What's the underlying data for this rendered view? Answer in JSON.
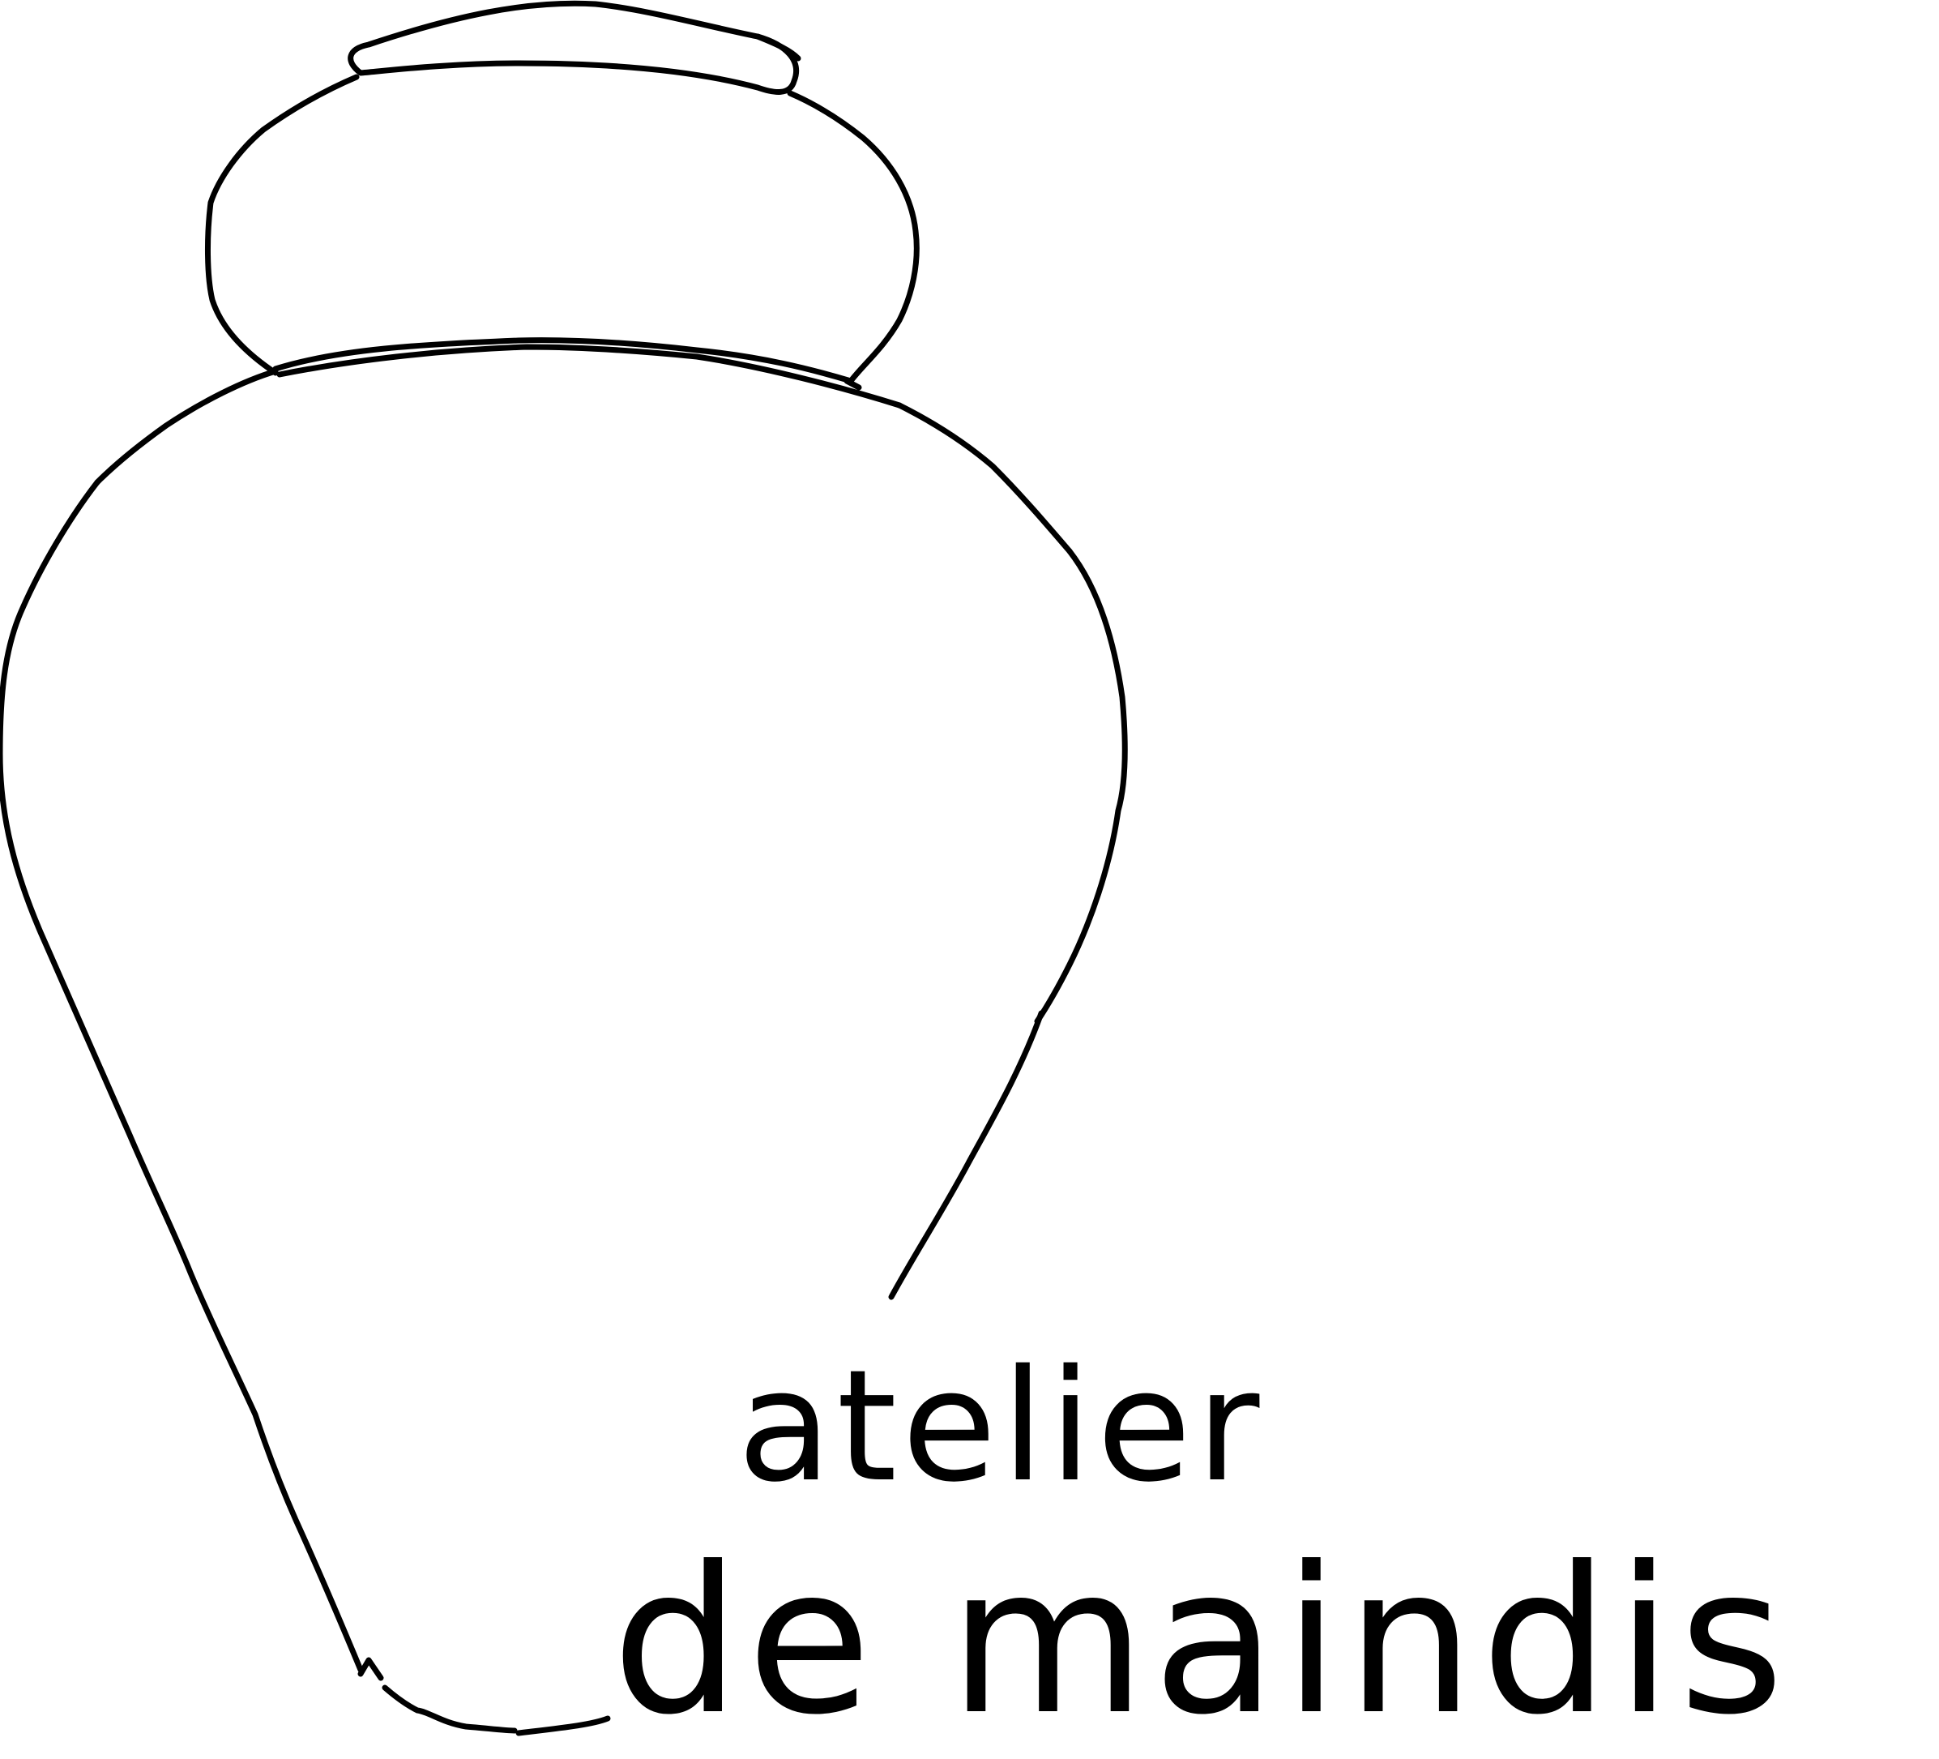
{
  "logo": {
    "name_line_1": "atelier",
    "name_line_2": "de maindis",
    "ink_color": "#000000",
    "background_color": "#ffffff",
    "illustration": "vase-line-drawing"
  }
}
